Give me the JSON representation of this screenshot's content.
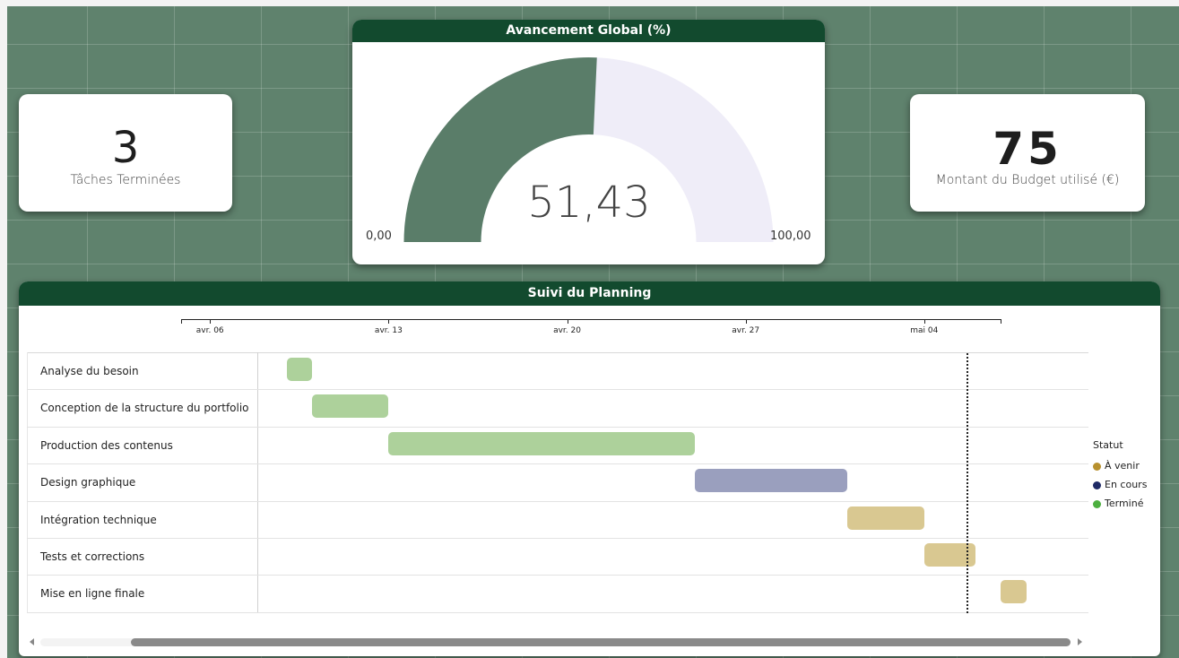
{
  "kpi_left": {
    "value": "3",
    "label": "Tâches Terminées"
  },
  "kpi_right": {
    "value": "75",
    "label": "Montant du Budget utilisé (€)"
  },
  "gauge": {
    "title": "Avancement Global (%)",
    "value": 51.43,
    "value_label": "51,43",
    "min": 0,
    "max": 100,
    "min_label": "0,00",
    "max_label": "100,00",
    "fill_color": "#5a7d69",
    "track_color": "#efedf8"
  },
  "planning": {
    "title": "Suivi du Planning",
    "axis_ticks": [
      "avr. 06",
      "avr. 13",
      "avr. 20",
      "avr. 27",
      "mai 04"
    ],
    "legend": {
      "title": "Statut",
      "items": [
        {
          "label": "À venir",
          "color": "#b8912e"
        },
        {
          "label": "En cours",
          "color": "#1f2a66"
        },
        {
          "label": "Terminé",
          "color": "#4caf3f"
        }
      ]
    },
    "today_marker_day": 32.6
  },
  "chart_data": {
    "type": "gantt",
    "x_axis": "date",
    "ticks": [
      "avr. 06",
      "avr. 13",
      "avr. 20",
      "avr. 27",
      "mai 04"
    ],
    "tasks": [
      {
        "name": "Analyse du besoin",
        "start": "2025-04-09",
        "end": "2025-04-10",
        "status": "Terminé"
      },
      {
        "name": "Conception de la structure du portfolio",
        "start": "2025-04-10",
        "end": "2025-04-13",
        "status": "Terminé"
      },
      {
        "name": "Production des contenus",
        "start": "2025-04-13",
        "end": "2025-04-25",
        "status": "Terminé"
      },
      {
        "name": "Design graphique",
        "start": "2025-04-25",
        "end": "2025-05-01",
        "status": "En cours"
      },
      {
        "name": "Intégration technique",
        "start": "2025-05-01",
        "end": "2025-05-04",
        "status": "À venir"
      },
      {
        "name": "Tests et corrections",
        "start": "2025-05-04",
        "end": "2025-05-06",
        "status": "À venir"
      },
      {
        "name": "Mise en ligne finale",
        "start": "2025-05-07",
        "end": "2025-05-08",
        "status": "À venir"
      }
    ],
    "status_colors": {
      "Terminé": "#add19b",
      "En cours": "#9a9fbe",
      "À venir": "#d9c891"
    }
  }
}
